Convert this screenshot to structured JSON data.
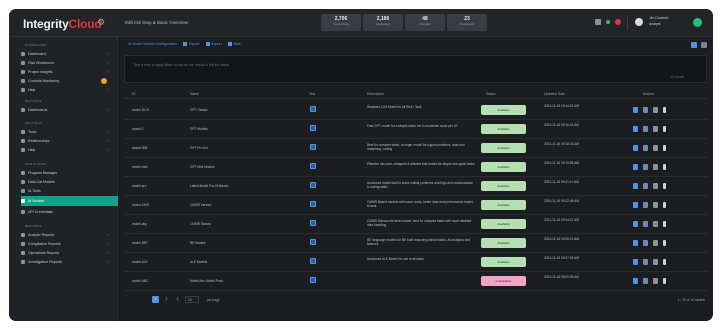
{
  "app": {
    "logo_main": "Integrity",
    "logo_accent": "Cloud",
    "breadcrumb": "Edit risk Step & Basic Overview"
  },
  "kpis": [
    {
      "value": "2,706",
      "label": "Open Risks"
    },
    {
      "value": "2,186",
      "label": "Evaluated"
    },
    {
      "value": "48",
      "label": "Overdue"
    },
    {
      "value": "23",
      "label": "Treatments"
    }
  ],
  "user": {
    "name": "Jim Dowbert",
    "role": "Analyst"
  },
  "colors": {
    "accent": "#17a088",
    "link": "#4f95e6",
    "status_ok": "#b6e0b2",
    "status_critical": "#f2a3c8",
    "frame_bg": "#1c1d20"
  },
  "sidebar": {
    "sections": [
      {
        "title": "DASHBOARD",
        "items": [
          {
            "label": "Dashboard",
            "icon": "grid-icon",
            "chevron": true
          },
          {
            "label": "Risk Workbench",
            "icon": "workbench-icon",
            "chevron": true
          },
          {
            "label": "Project Insights",
            "icon": "insights-icon",
            "chevron": true
          },
          {
            "label": "Controls Monitoring",
            "icon": "monitor-icon",
            "chevron": false,
            "badge": true
          },
          {
            "label": "Help",
            "icon": "help-icon",
            "chevron": true
          }
        ]
      },
      {
        "title": "REPORTS",
        "items": [
          {
            "label": "Dashboards",
            "icon": "chart-icon",
            "chevron": true
          }
        ]
      },
      {
        "title": "SETTINGS",
        "items": [
          {
            "label": "Tools",
            "icon": "tools-icon",
            "chevron": true
          },
          {
            "label": "Relationships",
            "icon": "link-icon",
            "chevron": true
          },
          {
            "label": "Help",
            "icon": "help-icon",
            "chevron": true
          }
        ]
      },
      {
        "title": "ADMIN ZONE",
        "items": [
          {
            "label": "Program Manager",
            "icon": "folder-icon",
            "chevron": false
          },
          {
            "label": "Data Cat Models",
            "icon": "database-icon",
            "chevron": false
          },
          {
            "label": "AI Tools",
            "icon": "ai-icon",
            "chevron": false
          },
          {
            "label": "AI Models",
            "icon": "model-icon",
            "chevron": false,
            "active": true
          },
          {
            "label": "API Credentials",
            "icon": "key-icon",
            "chevron": false
          }
        ]
      },
      {
        "title": "REPORTS",
        "items": [
          {
            "label": "Analytic Reports",
            "icon": "report-icon",
            "chevron": true
          },
          {
            "label": "Compliance Reports",
            "icon": "compliance-icon",
            "chevron": true
          },
          {
            "label": "Operations Reports",
            "icon": "operations-icon",
            "chevron": true
          },
          {
            "label": "Investigation Reports",
            "icon": "search-icon",
            "chevron": true
          }
        ]
      }
    ]
  },
  "tabs": [
    {
      "label": "AI Model Models Configuration"
    },
    {
      "label": "Export"
    },
    {
      "label": "Import"
    },
    {
      "label": "Bulk"
    }
  ],
  "filter": {
    "placeholder": "Type a term or apply filters to narrow the results in the list below",
    "count": "10 results"
  },
  "table": {
    "headers": [
      "ID",
      "Name",
      "Test",
      "Description",
      "Status",
      "Updated Date",
      "Actions"
    ],
    "rows": [
      {
        "id": "model-ID-01",
        "name": "GPT Classic",
        "desc": "Standard LLM Model for all Risk / Task",
        "status": "Available",
        "date": "2024-11-18 09:14:22 AM"
      },
      {
        "id": "model-2",
        "name": "GPT Models",
        "desc": "Fast GPT model for a simple tasks run in moderate costs per 1K",
        "status": "Available",
        "date": "2024-11-18 09:16:41 AM"
      },
      {
        "id": "model-3ML",
        "name": "GPT Pro Ext",
        "desc": "Best for complex tasks, a longer model for logical problems, data and reasoning, coding",
        "status": "Available",
        "date": "2024-11-18 09:18:03 AM"
      },
      {
        "id": "model-mini",
        "name": "GPT Mini Models",
        "desc": "Effective low-cost, cheapest & efficient fast model for simple and quick tasks",
        "status": "Available",
        "date": "2024-11-18 09:19:55 AM"
      },
      {
        "id": "model-pro",
        "name": "Latest Model Pro-Hi-Bench",
        "desc": "Advanced model built to solve critical problems and high-end customization & coding tasks",
        "status": "Available",
        "date": "2024-11-18 09:21:10 AM"
      },
      {
        "id": "model-CMR",
        "name": "CMMR Version",
        "desc": "CMMR Based models with lower costs, better data and performance based to task",
        "status": "Available",
        "date": "2024-11-18 09:22:48 AM"
      },
      {
        "id": "model-dcp",
        "name": "CMMR Stanza",
        "desc": "CMMR Stanza mid-level model, best for complex tasks with more detailed data handling",
        "status": "Available",
        "date": "2024-11-18 09:24:37 AM"
      },
      {
        "id": "model-BET",
        "name": "BE Models",
        "desc": "BE language models for BE built reasoning based tasks, all analytics and features",
        "status": "Available",
        "date": "2024-11-18 09:26:19 AM"
      },
      {
        "id": "model-ALE",
        "name": "ALE Models",
        "desc": "Advanced ALE Model for use in all tasks",
        "status": "Available",
        "date": "2024-11-18 09:27:52 AM"
      },
      {
        "id": "model-ABC",
        "name": "Model Abc-Model-Proto",
        "desc": "",
        "status": "Unavailable",
        "date": "2024-11-18 09:29:06 AM"
      }
    ]
  },
  "pager": {
    "pages": [
      "1",
      "2",
      "3"
    ],
    "page_size": "10",
    "info": "per page",
    "showing": "1 - 10 of 10 models"
  }
}
